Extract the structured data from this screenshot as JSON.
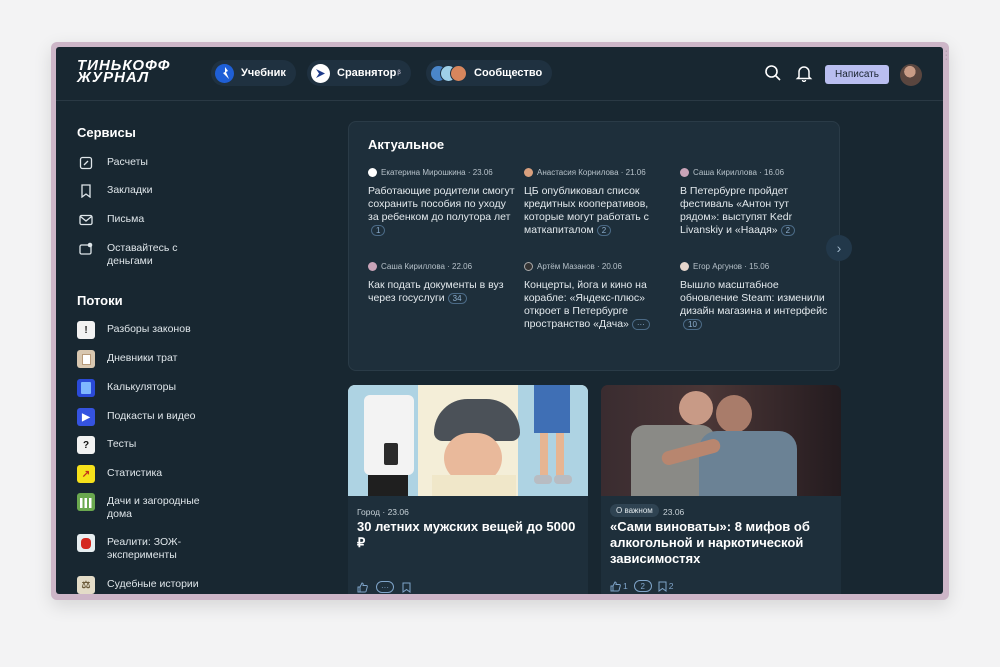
{
  "header": {
    "logo_line1": "ТИНЬКОФФ",
    "logo_line2": "ЖУРНАЛ",
    "nav": [
      {
        "label": "Учебник"
      },
      {
        "label": "Сравнятор",
        "sup": "β"
      },
      {
        "label": "Сообщество"
      }
    ],
    "write_label": "Написать"
  },
  "sidebar": {
    "services_title": "Сервисы",
    "services": [
      {
        "label": "Расчеты",
        "icon": "calc-tag-icon"
      },
      {
        "label": "Закладки",
        "icon": "bookmark-icon"
      },
      {
        "label": "Письма",
        "icon": "mail-icon"
      },
      {
        "label": "Оставайтесь с деньгами",
        "icon": "money-mail-icon"
      }
    ],
    "streams_title": "Потоки",
    "streams": [
      {
        "label": "Разборы законов",
        "icon": "exclamation-icon",
        "color": "#f2f2f2",
        "glyph": "!"
      },
      {
        "label": "Дневники трат",
        "icon": "diary-icon",
        "color": "#d8c7b0",
        "glyph": ""
      },
      {
        "label": "Калькуляторы",
        "icon": "calculator-icon",
        "color": "#2a4ad8",
        "glyph": ""
      },
      {
        "label": "Подкасты и видео",
        "icon": "play-icon",
        "color": "#3553e0",
        "glyph": "▶"
      },
      {
        "label": "Тесты",
        "icon": "question-icon",
        "color": "#f2f2f2",
        "glyph": "?"
      },
      {
        "label": "Статистика",
        "icon": "stats-arrow-icon",
        "color": "#f6e11b",
        "glyph": "↗"
      },
      {
        "label": "Дачи и загородные дома",
        "icon": "fence-icon",
        "color": "#6aa84f",
        "glyph": ""
      },
      {
        "label": "Реалити: ЗОЖ-эксперименты",
        "icon": "boxing-glove-icon",
        "color": "#e7eef0",
        "glyph": ""
      },
      {
        "label": "Судебные истории",
        "icon": "scales-icon",
        "color": "#e3dcc8",
        "glyph": "⚖"
      }
    ]
  },
  "actual": {
    "title": "Актуальное",
    "items": [
      {
        "author": "Екатерина Мирошкина",
        "date": "23.06",
        "text": "Работающие родители смогут сохранить пособия по уходу за ребенком до полутора лет",
        "count": "1"
      },
      {
        "author": "Анастасия Корнилова",
        "date": "21.06",
        "text": "ЦБ опубликовал список кредитных кооперативов, которые могут работать с маткапиталом",
        "count": "2"
      },
      {
        "author": "Саша Кириллова",
        "date": "16.06",
        "text": "В Петербурге пройдет фестиваль «Антон тут рядом»: выступят Kedr Livanskiy и «Наадя»",
        "count": "2"
      },
      {
        "author": "Саша Кириллова",
        "date": "22.06",
        "text": "Как подать документы в вуз через госуслуги",
        "count": "34"
      },
      {
        "author": "Артём Мазанов",
        "date": "20.06",
        "text": "Концерты, йога и кино на корабле: «Яндекс-плюс» откроет в Петербурге пространство «Дача»",
        "count": "···"
      },
      {
        "author": "Егор Аргунов",
        "date": "15.06",
        "text": "Вышло масштабное обновление Steam: изменили дизайн магазина и интерфейс",
        "count": "10"
      }
    ]
  },
  "cards": [
    {
      "category": "Город",
      "date": "23.06",
      "title": "30 летних мужских вещей до 5000 ₽",
      "likes": "",
      "comments": "",
      "saves": ""
    },
    {
      "badge": "О важном",
      "date": "23.06",
      "title": "«Сами виноваты»: 8 мифов об алкогольной и наркотической зависимостях",
      "likes": "1",
      "comments": "2",
      "saves": "2"
    }
  ]
}
